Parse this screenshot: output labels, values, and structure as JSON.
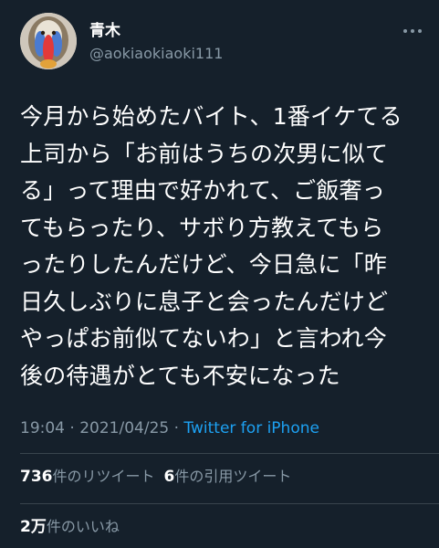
{
  "author": {
    "display_name": "青木",
    "handle": "@aokiaokiaoki111"
  },
  "tweet": {
    "text": "今月から始めたバイト、1番イケてる\n上司から「お前はうちの次男に似て\nる」って理由で好かれて、ご飯奢っ\nてもらったり、サボり方教えてもら\nったりしたんだけど、今日急に「昨\n日久しぶりに息子と会ったんだけど\nやっぱお前似てないわ」と言われ今\n後の待遇がとても不安になった",
    "time": "19:04",
    "separator": "·",
    "date": "2021/04/25",
    "source": "Twitter for iPhone"
  },
  "stats": {
    "retweets_count": "736",
    "retweets_label": "件のリツイート",
    "quotes_count": "6",
    "quotes_label": "件の引用ツイート",
    "likes_count": "2万",
    "likes_label": "件のいいね"
  },
  "colors": {
    "background": "#15202b",
    "text_primary": "#ffffff",
    "text_secondary": "#8899a6",
    "accent": "#1da1f2",
    "divider": "#38444d"
  },
  "icons": {
    "more": "more-horizontal-icon"
  }
}
